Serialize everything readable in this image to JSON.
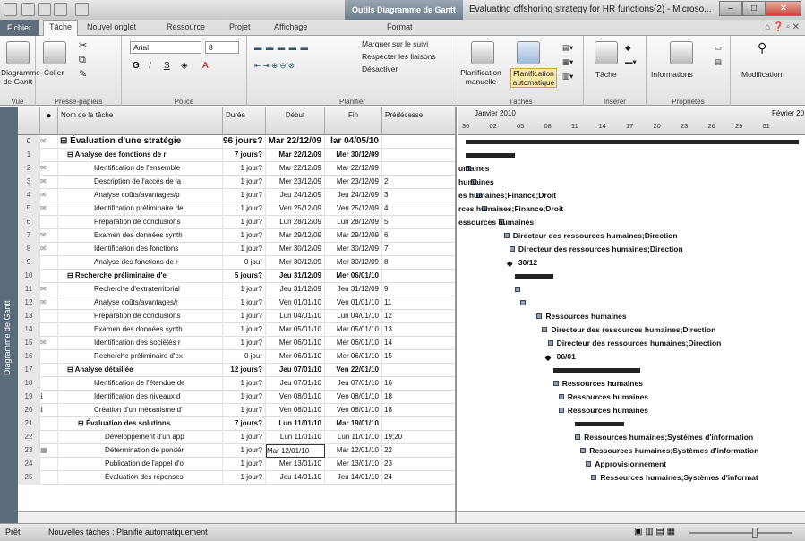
{
  "window": {
    "title": "Evaluating offshoring strategy for HR functions(2)  -  Microso...",
    "context_tool": "Outils Diagramme de Gantt"
  },
  "tabs": [
    {
      "label": "Fichier"
    },
    {
      "label": "Tâche"
    },
    {
      "label": "Nouvel onglet"
    },
    {
      "label": "Ressource"
    },
    {
      "label": "Projet"
    },
    {
      "label": "Affichage"
    },
    {
      "label": "Format"
    }
  ],
  "ribbon": {
    "vue": {
      "button": "Diagramme de Gantt",
      "label": "Vue"
    },
    "presse": {
      "coller": "Coller",
      "label": "Presse-papiers"
    },
    "police": {
      "font": "Arial",
      "size": "8",
      "label": "Police",
      "bold": "G",
      "italic": "I",
      "underline": "S"
    },
    "planifier": {
      "mark": "Marquer sur le suivi",
      "respect": "Respecter les liaisons",
      "disable": "Désactiver",
      "label": "Planifier"
    },
    "taches": {
      "manual": "Planification manuelle",
      "auto": "Planification automatique",
      "label": "Tâches"
    },
    "inserer": {
      "tache": "Tâche",
      "label": "Insérer"
    },
    "proprietes": {
      "info": "Informations",
      "label": "Propriétés"
    },
    "modif": {
      "label": "Modification"
    }
  },
  "side_label": "Diagramme de Gantt",
  "columns": {
    "num": "",
    "info": "",
    "name": "Nom de la tâche",
    "duration": "Durée",
    "start": "Début",
    "finish": "Fin",
    "pred": "Prédécesse"
  },
  "timescale": {
    "month1": "Janvier 2010",
    "month2": "Février 20",
    "days": [
      "30",
      "02",
      "05",
      "08",
      "11",
      "14",
      "17",
      "20",
      "23",
      "26",
      "29",
      "01"
    ]
  },
  "rows": [
    {
      "n": "0",
      "ind": "note",
      "name": "Évaluation d'une stratégie",
      "dur": "96 jours?",
      "start": "Mar 22/12/09",
      "fin": "lar 04/05/10",
      "pred": "",
      "bold": "true",
      "summary": "true",
      "level": "0"
    },
    {
      "n": "1",
      "ind": "",
      "name": "Analyse des fonctions de r",
      "dur": "7 jours?",
      "start": "Mar 22/12/09",
      "fin": "Mer 30/12/09",
      "pred": "",
      "bold": "true",
      "summary": "true",
      "level": "1"
    },
    {
      "n": "2",
      "ind": "note",
      "name": "Identification de l'ensemble",
      "dur": "1 jour?",
      "start": "Mar 22/12/09",
      "fin": "Mar 22/12/09",
      "pred": "",
      "level": "2"
    },
    {
      "n": "3",
      "ind": "note",
      "name": "Description de l'accès de la",
      "dur": "1 jour?",
      "start": "Mer 23/12/09",
      "fin": "Mer 23/12/09",
      "pred": "2",
      "level": "2"
    },
    {
      "n": "4",
      "ind": "note",
      "name": "Analyse coûts/avantages/p",
      "dur": "1 jour?",
      "start": "Jeu 24/12/09",
      "fin": "Jeu 24/12/09",
      "pred": "3",
      "level": "2"
    },
    {
      "n": "5",
      "ind": "note",
      "name": "Identification préliminaire de",
      "dur": "1 jour?",
      "start": "Ven 25/12/09",
      "fin": "Ven 25/12/09",
      "pred": "4",
      "level": "2"
    },
    {
      "n": "6",
      "ind": "",
      "name": "Préparation de conclusions",
      "dur": "1 jour?",
      "start": "Lun 28/12/09",
      "fin": "Lun 28/12/09",
      "pred": "5",
      "level": "2"
    },
    {
      "n": "7",
      "ind": "note",
      "name": "Examen des données synth",
      "dur": "1 jour?",
      "start": "Mar 29/12/09",
      "fin": "Mar 29/12/09",
      "pred": "6",
      "level": "2"
    },
    {
      "n": "8",
      "ind": "note",
      "name": "Identification des fonctions",
      "dur": "1 jour?",
      "start": "Mer 30/12/09",
      "fin": "Mer 30/12/09",
      "pred": "7",
      "level": "2"
    },
    {
      "n": "9",
      "ind": "",
      "name": "Analyse des fonctions de r",
      "dur": "0 jour",
      "start": "Mer 30/12/09",
      "fin": "Mer 30/12/09",
      "pred": "8",
      "level": "2"
    },
    {
      "n": "10",
      "ind": "",
      "name": "Recherche préliminaire d'e",
      "dur": "5 jours?",
      "start": "Jeu 31/12/09",
      "fin": "Mer 06/01/10",
      "pred": "",
      "bold": "true",
      "summary": "true",
      "level": "1"
    },
    {
      "n": "11",
      "ind": "note",
      "name": "Recherche d'extraterritorial",
      "dur": "1 jour?",
      "start": "Jeu 31/12/09",
      "fin": "Jeu 31/12/09",
      "pred": "9",
      "level": "2"
    },
    {
      "n": "12",
      "ind": "note",
      "name": "Analyse coûts/avantages/r",
      "dur": "1 jour?",
      "start": "Ven 01/01/10",
      "fin": "Ven 01/01/10",
      "pred": "11",
      "level": "2"
    },
    {
      "n": "13",
      "ind": "",
      "name": "Préparation de conclusions",
      "dur": "1 jour?",
      "start": "Lun 04/01/10",
      "fin": "Lun 04/01/10",
      "pred": "12",
      "level": "2"
    },
    {
      "n": "14",
      "ind": "",
      "name": "Examen des données synth",
      "dur": "1 jour?",
      "start": "Mar 05/01/10",
      "fin": "Mar 05/01/10",
      "pred": "13",
      "level": "2"
    },
    {
      "n": "15",
      "ind": "note",
      "name": "Identification des sociétés r",
      "dur": "1 jour?",
      "start": "Mer 06/01/10",
      "fin": "Mer 06/01/10",
      "pred": "14",
      "level": "2"
    },
    {
      "n": "16",
      "ind": "",
      "name": "Recherche préliminaire d'ex",
      "dur": "0 jour",
      "start": "Mer 06/01/10",
      "fin": "Mer 06/01/10",
      "pred": "15",
      "level": "2"
    },
    {
      "n": "17",
      "ind": "",
      "name": "Analyse détaillée",
      "dur": "12 jours?",
      "start": "Jeu 07/01/10",
      "fin": "Ven 22/01/10",
      "pred": "",
      "bold": "true",
      "summary": "true",
      "level": "1"
    },
    {
      "n": "18",
      "ind": "",
      "name": "Identification de l'étendue de",
      "dur": "1 jour?",
      "start": "Jeu 07/01/10",
      "fin": "Jeu 07/01/10",
      "pred": "16",
      "level": "2"
    },
    {
      "n": "19",
      "ind": "info",
      "name": "Identification des niveaux d",
      "dur": "1 jour?",
      "start": "Ven 08/01/10",
      "fin": "Ven 08/01/10",
      "pred": "18",
      "level": "2"
    },
    {
      "n": "20",
      "ind": "info",
      "name": "Création d'un mécanisme d'",
      "dur": "1 jour?",
      "start": "Ven 08/01/10",
      "fin": "Ven 08/01/10",
      "pred": "18",
      "level": "2"
    },
    {
      "n": "21",
      "ind": "",
      "name": "Évaluation des solutions",
      "dur": "7 jours?",
      "start": "Lun 11/01/10",
      "fin": "Mar 19/01/10",
      "pred": "",
      "bold": "true",
      "summary": "true",
      "level": "2"
    },
    {
      "n": "22",
      "ind": "",
      "name": "Développement d'un app",
      "dur": "1 jour?",
      "start": "Lun 11/01/10",
      "fin": "Lun 11/01/10",
      "pred": "19;20",
      "level": "3"
    },
    {
      "n": "23",
      "ind": "grid",
      "name": "Détermination de pondér",
      "dur": "1 jour?",
      "start": "Mar 12/01/10",
      "fin": "Mar 12/01/10",
      "pred": "22",
      "level": "3",
      "editing": "true"
    },
    {
      "n": "24",
      "ind": "",
      "name": "Publication de l'appel d'o",
      "dur": "1 jour?",
      "start": "Mer 13/01/10",
      "fin": "Mer 13/01/10",
      "pred": "23",
      "level": "3"
    },
    {
      "n": "25",
      "ind": "",
      "name": "Évaluation des réponses",
      "dur": "1 jour?",
      "start": "Jeu 14/01/10",
      "fin": "Jeu 14/01/10",
      "pred": "24",
      "level": "3"
    }
  ],
  "gantt_labels": [
    {
      "row": "2",
      "text": "umaines"
    },
    {
      "row": "3",
      "text": "humaines"
    },
    {
      "row": "4",
      "text": "es humaines;Finance;Droit"
    },
    {
      "row": "5",
      "text": "rces humaines;Finance;Droit"
    },
    {
      "row": "6",
      "text": "essources humaines"
    },
    {
      "row": "7",
      "text": "Directeur des ressources humaines;Direction"
    },
    {
      "row": "8",
      "text": "Directeur des ressources humaines;Direction"
    },
    {
      "row": "9",
      "text": "30/12"
    },
    {
      "row": "13",
      "text": "Ressources humaines"
    },
    {
      "row": "14",
      "text": "Directeur des ressources humaines;Direction"
    },
    {
      "row": "15",
      "text": "Directeur des ressources humaines;Direction"
    },
    {
      "row": "16",
      "text": "06/01"
    },
    {
      "row": "18",
      "text": "Ressources humaines"
    },
    {
      "row": "19",
      "text": "Ressources humaines"
    },
    {
      "row": "20",
      "text": "Ressources humaines"
    },
    {
      "row": "22",
      "text": "Ressources humaines;Systèmes d'information"
    },
    {
      "row": "23",
      "text": "Ressources humaines;Systèmes d'information"
    },
    {
      "row": "24",
      "text": "Approvisionnement"
    },
    {
      "row": "25",
      "text": "Ressources humaines;Systèmes d'informat"
    }
  ],
  "status": {
    "ready": "Prêt",
    "new_tasks": "Nouvelles tâches : Planifié automatiquement"
  }
}
